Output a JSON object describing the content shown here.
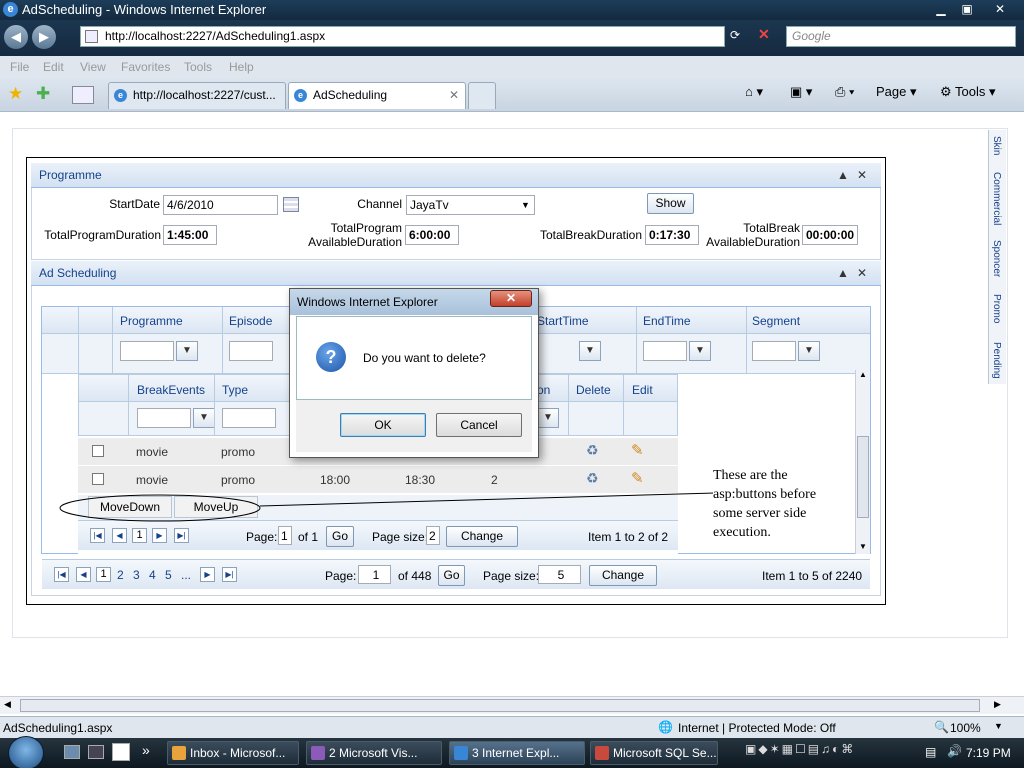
{
  "window": {
    "title": "AdScheduling - Windows Internet Explorer",
    "min": "▁",
    "max": "▣",
    "close": "✕"
  },
  "address": {
    "url": "http://localhost:2227/AdScheduling1.aspx",
    "search_placeholder": "Google"
  },
  "menu": {
    "items": [
      "File",
      "Edit",
      "View",
      "Favorites",
      "Tools",
      "Help"
    ]
  },
  "tabs": [
    {
      "label": "http://localhost:2227/cust..."
    },
    {
      "label": "AdScheduling"
    }
  ],
  "toolbar": {
    "page": "Page",
    "tools": "Tools"
  },
  "sidebar": {
    "items": [
      "Skin",
      "Commercial",
      "Sponcer",
      "Promo",
      "Pending"
    ]
  },
  "programme": {
    "header": "Programme",
    "start_date_label": "StartDate",
    "start_date_value": "4/6/2010",
    "channel_label": "Channel",
    "channel_value": "JayaTv",
    "show_button": "Show",
    "total_program_duration_label": "TotalProgramDuration",
    "total_program_duration_value": "1:45:00",
    "total_program_available_label_1": "TotalProgram",
    "total_program_available_label_2": "AvailableDuration",
    "total_program_available_value": "6:00:00",
    "total_break_duration_label": "TotalBreakDuration",
    "total_break_duration_value": "0:17:30",
    "total_break_available_label_1": "TotalBreak",
    "total_break_available_label_2": "AvailableDuration",
    "total_break_available_value": "00:00:00"
  },
  "ad_scheduling": {
    "header": "Ad Scheduling",
    "columns": [
      "Programme",
      "Episode",
      "StartTime",
      "EndTime",
      "Segment"
    ],
    "inner": {
      "columns": [
        "BreakEvents",
        "Type",
        "Delete",
        "Edit"
      ],
      "col_partial": "on",
      "rows": [
        {
          "break_event": "movie",
          "type": "promo",
          "start": "",
          "end": "",
          "segment": ""
        },
        {
          "break_event": "movie",
          "type": "promo",
          "start": "18:00",
          "end": "18:30",
          "segment": "2"
        }
      ],
      "move_down": "MoveDown",
      "move_up": "MoveUp",
      "pager": {
        "page_label": "Page:",
        "page": "1",
        "of": "of 1",
        "go": "Go",
        "size_label": "Page size:",
        "size": "2",
        "change": "Change",
        "summary": "Item 1 to 2 of 2",
        "current": "1"
      }
    },
    "pager": {
      "pages": [
        "1",
        "2",
        "3",
        "4",
        "5",
        "..."
      ],
      "page_label": "Page:",
      "page": "1",
      "of": "of 448",
      "go": "Go",
      "size_label": "Page size:",
      "size": "5",
      "change": "Change",
      "summary": "Item 1 to 5 of 2240"
    }
  },
  "annotation": "These are the asp:buttons before some server side execution.",
  "dialog": {
    "title": "Windows Internet Explorer",
    "message": "Do you want to delete?",
    "ok": "OK",
    "cancel": "Cancel",
    "icon": "?"
  },
  "status": {
    "left": "AdScheduling1.aspx",
    "zone": "Internet | Protected Mode: Off",
    "zoom": "100%"
  },
  "taskbar": {
    "items": [
      {
        "label": "Inbox - Microsof...",
        "color": "#e8a33c"
      },
      {
        "label": "2 Microsoft Vis...",
        "color": "#8c5ab8"
      },
      {
        "label": "3 Internet Expl...",
        "color": "#3a86d6"
      },
      {
        "label": "Microsoft SQL Se...",
        "color": "#c94a3c"
      }
    ],
    "clock": "7:19 PM"
  }
}
